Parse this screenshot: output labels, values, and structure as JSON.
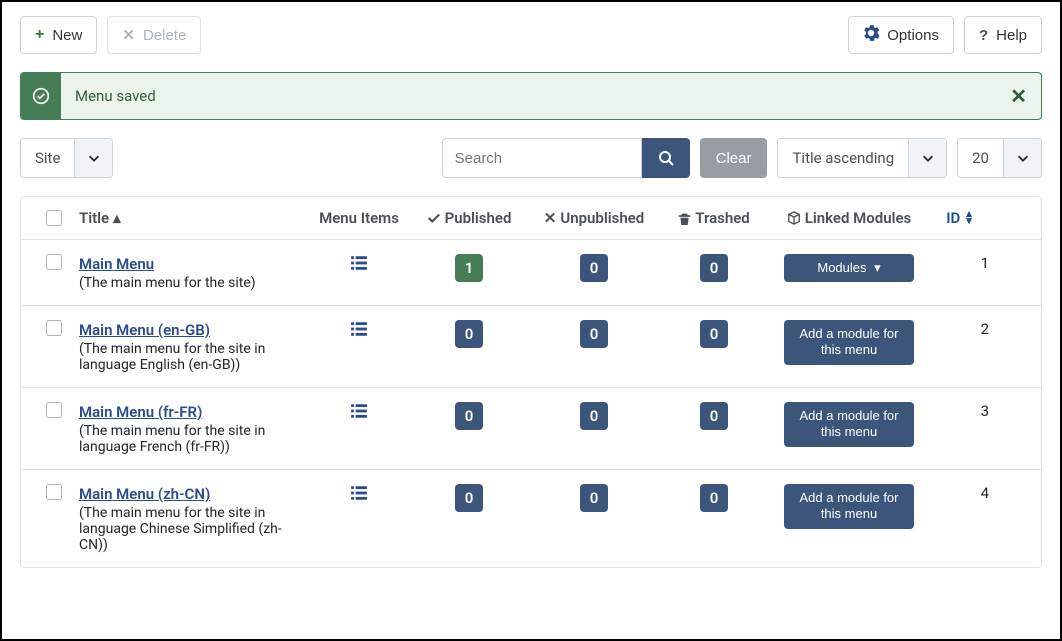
{
  "toolbar": {
    "new_label": "New",
    "delete_label": "Delete",
    "options_label": "Options",
    "help_label": "Help"
  },
  "alert": {
    "message": "Menu saved"
  },
  "filters": {
    "site_label": "Site",
    "search_placeholder": "Search",
    "clear_label": "Clear",
    "sort_label": "Title ascending",
    "limit_label": "20"
  },
  "columns": {
    "title": "Title",
    "menu_items": "Menu Items",
    "published": "Published",
    "unpublished": "Unpublished",
    "trashed": "Trashed",
    "linked_modules": "Linked Modules",
    "id": "ID"
  },
  "rows": [
    {
      "title": "Main Menu",
      "desc": "(The main menu for the site)",
      "published": "1",
      "published_green": true,
      "unpublished": "0",
      "trashed": "0",
      "module_label": "Modules",
      "module_has_caret": true,
      "id": "1"
    },
    {
      "title": "Main Menu (en-GB)",
      "desc": "(The main menu for the site in language English (en-GB))",
      "published": "0",
      "published_green": false,
      "unpublished": "0",
      "trashed": "0",
      "module_label": "Add a module for this menu",
      "module_has_caret": false,
      "id": "2"
    },
    {
      "title": "Main Menu (fr-FR)",
      "desc": "(The main menu for the site in language French (fr-FR))",
      "published": "0",
      "published_green": false,
      "unpublished": "0",
      "trashed": "0",
      "module_label": "Add a module for this menu",
      "module_has_caret": false,
      "id": "3"
    },
    {
      "title": "Main Menu (zh-CN)",
      "desc": "(The main menu for the site in language Chinese Simplified (zh-CN))",
      "published": "0",
      "published_green": false,
      "unpublished": "0",
      "trashed": "0",
      "module_label": "Add a module for this menu",
      "module_has_caret": false,
      "id": "4"
    }
  ]
}
